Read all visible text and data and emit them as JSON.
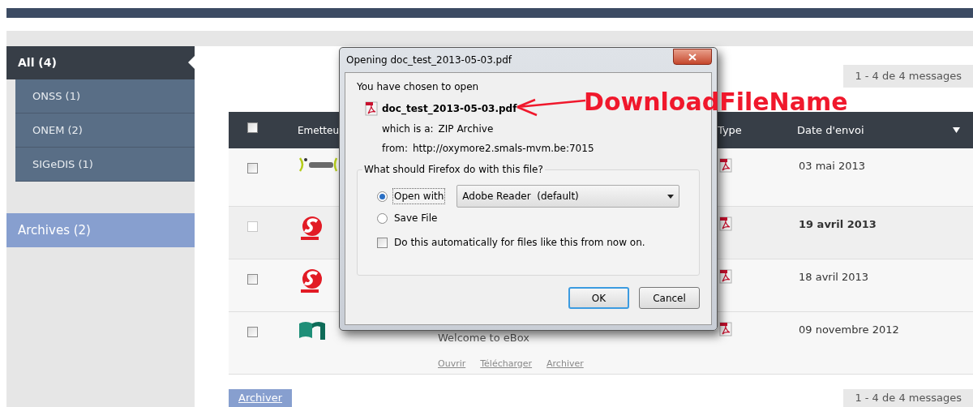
{
  "sidebar": {
    "groups": [
      {
        "label": "All (4)",
        "selected": true,
        "children": [
          {
            "label": "ONSS (1)",
            "selected": false
          },
          {
            "label": "ONEM (2)",
            "selected": false
          },
          {
            "label": "SIGeDIS (1)",
            "selected": false
          }
        ]
      }
    ],
    "archives": {
      "label": "Archives (2)",
      "selected": false
    }
  },
  "pager_top": "1 - 4 de 4 messages",
  "table": {
    "select_all": {
      "checked": false
    },
    "columns": [
      "Emetteu",
      "Type",
      "Date d'envoi"
    ],
    "rows": [
      {
        "checked": false,
        "kind": "sigedis",
        "date": "03 mai 2013",
        "unread": false
      },
      {
        "checked": false,
        "kind": "onem",
        "date": "19 avril 2013",
        "unread": true
      },
      {
        "checked": false,
        "kind": "onem",
        "date": "18 avril 2013",
        "unread": false
      },
      {
        "checked": false,
        "kind": "cylinder",
        "date": "09 novembre 2012",
        "unread": false,
        "subject": "Welcome to eBox",
        "actions": [
          "Ouvrir",
          "Télécharger",
          "Archiver"
        ]
      }
    ]
  },
  "archive_button": "Archiver",
  "pager_bottom": "1 - 4 de 4 messages",
  "dialog": {
    "title": "Opening doc_test_2013-05-03.pdf",
    "intro": "You have chosen to open",
    "file_name": "doc_test_2013-05-03.pdf",
    "type_label": "which is a:",
    "type": "ZIP Archive",
    "from_label": "from:",
    "url": "http://oxymore2.smals-mvm.be:7015",
    "question": "What should Firefox do with this file?",
    "options": [
      {
        "label": "Open with",
        "selected": true,
        "kind": "app"
      },
      {
        "label": "Save File",
        "selected": false,
        "kind": "plain"
      }
    ],
    "app": "Adobe Reader  (default)",
    "auto": {
      "label": "Do this automatically for files like this from now on.",
      "checked": false
    },
    "buttons": [
      {
        "label": "OK",
        "default": true
      },
      {
        "label": "Cancel",
        "default": false
      }
    ]
  },
  "annotation": "DownloadFileName"
}
